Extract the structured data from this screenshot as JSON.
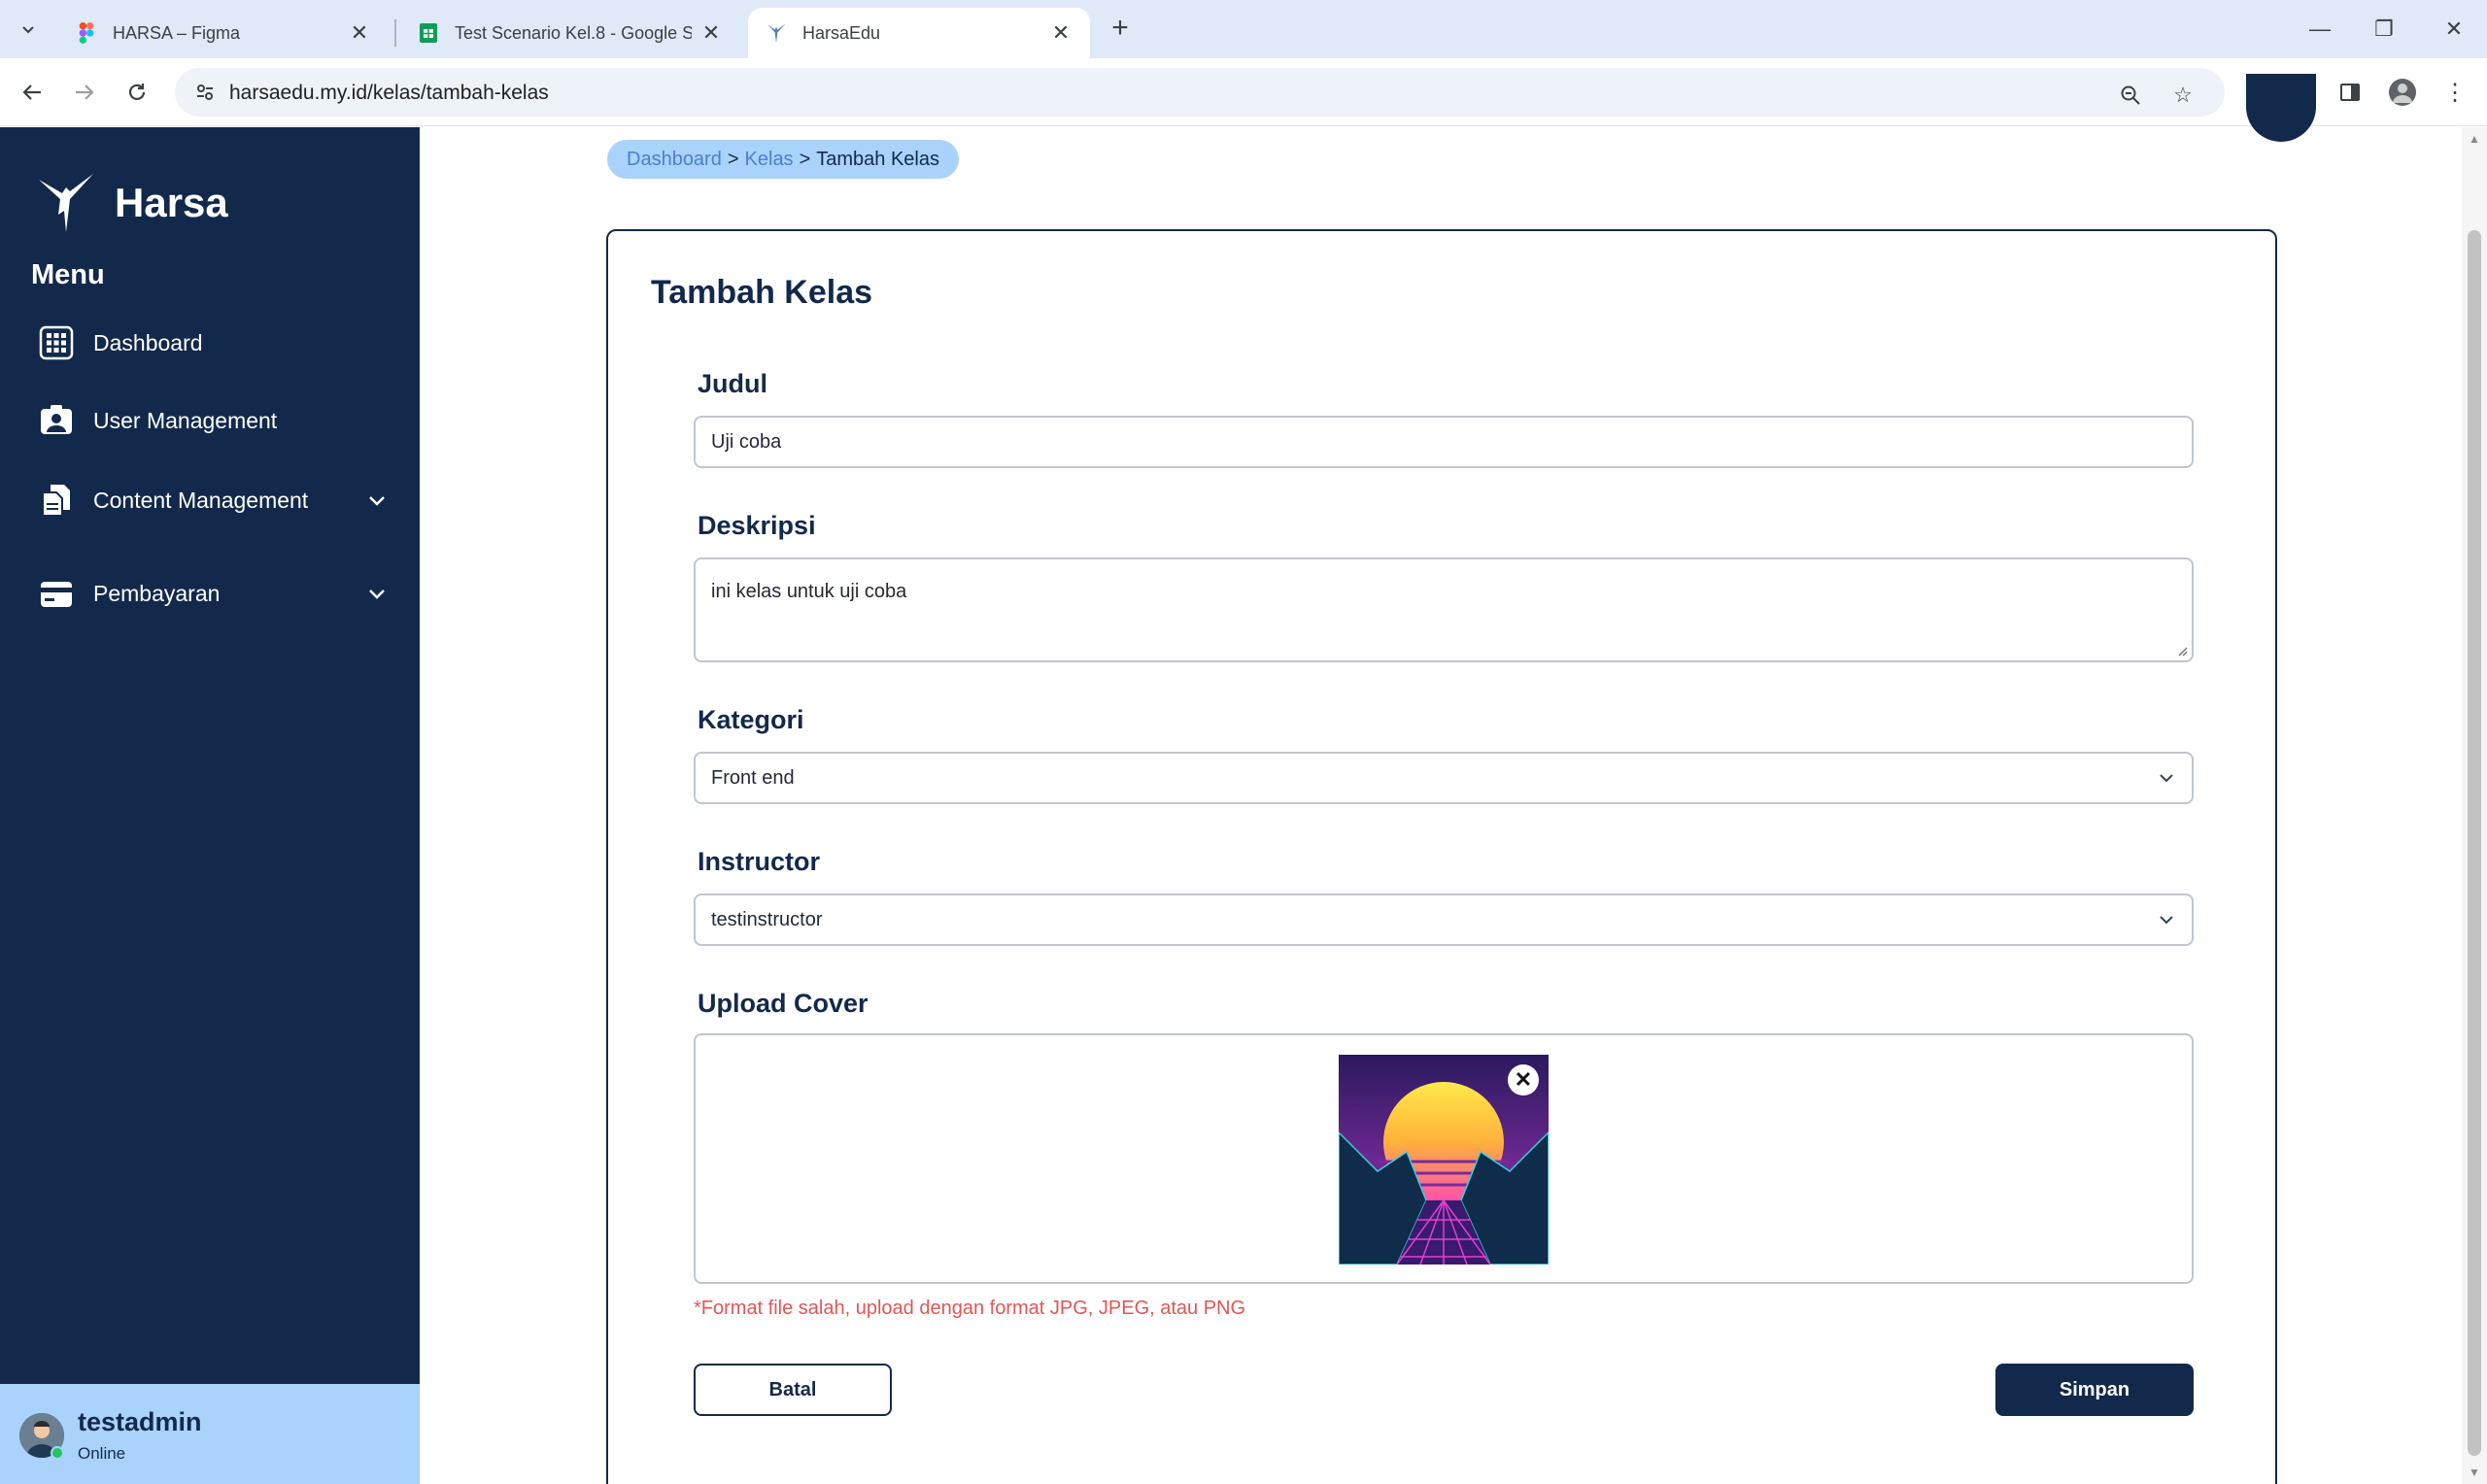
{
  "browser": {
    "tabs": [
      {
        "title": "HARSA – Figma",
        "icon": "figma-icon"
      },
      {
        "title": "Test Scenario Kel.8 - Google Sp",
        "icon": "google-sheets-icon"
      },
      {
        "title": "HarsaEdu",
        "icon": "harsa-bird-icon"
      }
    ],
    "url": "harsaedu.my.id/kelas/tambah-kelas"
  },
  "sidebar": {
    "brand": "Harsa",
    "menu_title": "Menu",
    "items": [
      {
        "label": "Dashboard",
        "icon": "dashboard-grid-icon"
      },
      {
        "label": "User Management",
        "icon": "user-card-icon"
      },
      {
        "label": "Content Management",
        "icon": "documents-icon",
        "expandable": true
      },
      {
        "label": "Pembayaran",
        "icon": "credit-card-icon",
        "expandable": true
      }
    ],
    "user": {
      "name": "testadmin",
      "status": "Online"
    }
  },
  "breadcrumb": {
    "items": [
      "Dashboard",
      "Kelas",
      "Tambah Kelas"
    ],
    "separator": ">"
  },
  "form": {
    "title": "Tambah Kelas",
    "judul": {
      "label": "Judul",
      "value": "Uji coba"
    },
    "deskripsi": {
      "label": "Deskripsi",
      "value": "ini kelas untuk uji coba"
    },
    "kategori": {
      "label": "Kategori",
      "value": "Front end"
    },
    "instructor": {
      "label": "Instructor",
      "value": "testinstructor"
    },
    "upload_cover": {
      "label": "Upload Cover"
    },
    "error": "*Format file salah, upload dengan format JPG, JPEG, atau PNG",
    "cancel_label": "Batal",
    "submit_label": "Simpan"
  },
  "colors": {
    "navy": "#13294b",
    "light_blue": "#a9d3fb",
    "error": "#e05757"
  }
}
